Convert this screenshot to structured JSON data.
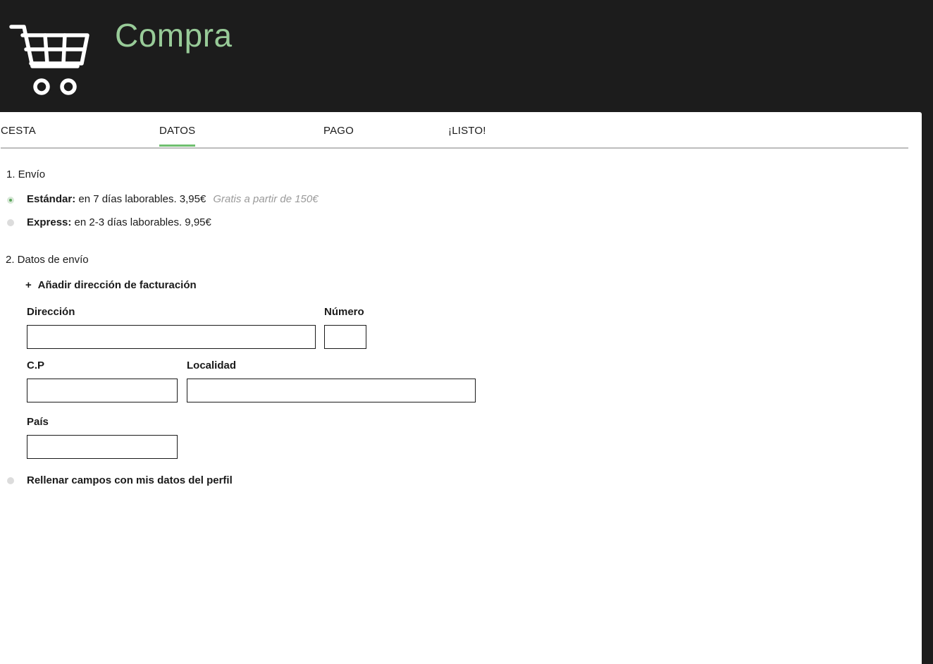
{
  "header": {
    "title": "Compra"
  },
  "tabs": [
    {
      "label": "CESTA",
      "active": false
    },
    {
      "label": "DATOS",
      "active": true
    },
    {
      "label": "PAGO",
      "active": false
    },
    {
      "label": "¡LISTO!",
      "active": false
    }
  ],
  "shipping": {
    "section_title": "1. Envío",
    "options": [
      {
        "name": "Estándar:",
        "detail": " en 7 días laborables. 3,95€",
        "hint": "Gratis a partir de 150€",
        "selected": true
      },
      {
        "name": "Express:",
        "detail": " en 2-3 días laborables. 9,95€",
        "hint": "",
        "selected": false
      }
    ]
  },
  "address": {
    "section_title": "2. Datos de envío",
    "add_billing_label": "Añadir dirección de facturación",
    "add_billing_symbol": "+",
    "fields": {
      "direccion": {
        "label": "Dirección",
        "value": ""
      },
      "numero": {
        "label": "Número",
        "value": ""
      },
      "cp": {
        "label": "C.P",
        "value": ""
      },
      "localidad": {
        "label": "Localidad",
        "value": ""
      },
      "pais": {
        "label": "País",
        "value": ""
      }
    },
    "prefill_label": "Rellenar campos con mis datos del perfil",
    "prefill_selected": false
  },
  "colors": {
    "accent": "#6fbf6f",
    "title": "#98cb98",
    "header_bg": "#1c1c1c"
  },
  "icons": {
    "cart": "shopping-cart-icon"
  }
}
